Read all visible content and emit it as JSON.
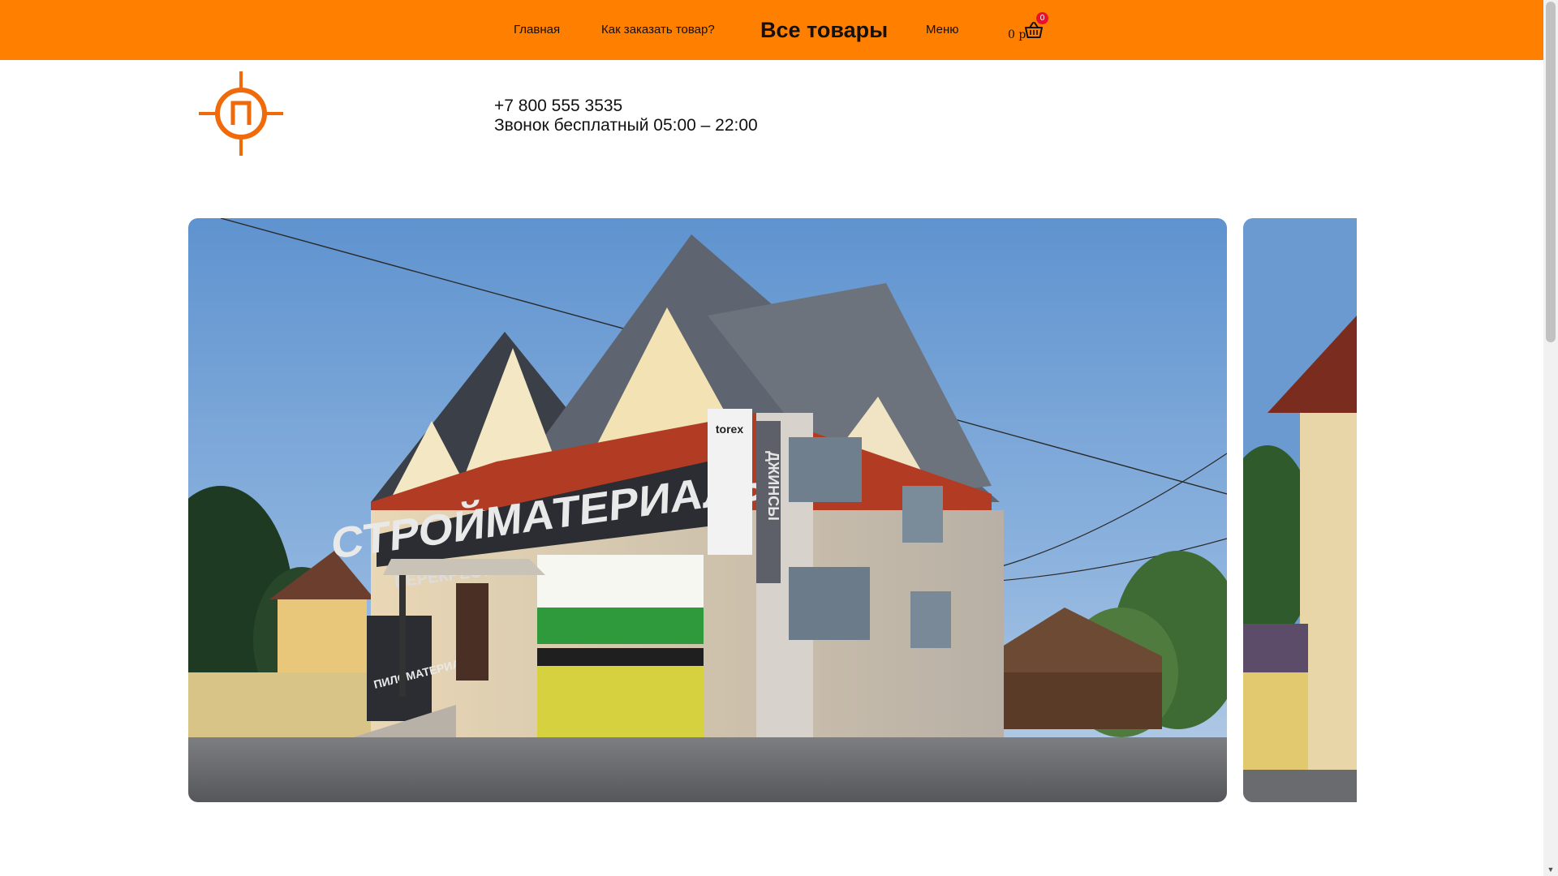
{
  "nav": {
    "home": "Главная",
    "how_to_order": "Как заказать товар?",
    "all_products": "Все товары",
    "menu": "Меню"
  },
  "cart": {
    "total": "0 р",
    "count": "0"
  },
  "contact": {
    "phone": "+7 800 555 3535",
    "hours": "Звонок бесплатный 05:00 – 22:00"
  },
  "logo": {
    "letter": "П"
  },
  "slider": {
    "sign_main": "СТРОЙМАТЕРИАЛЫ",
    "sign_sub": "ПЕРЕКРЕСТОК",
    "sign_side": "ДЖИНСЫ",
    "sign_torex": "torex",
    "sign_lower": "ПИЛОМАТЕРИАЛЫ"
  },
  "colors": {
    "accent": "#ff7f00",
    "badge": "#e8112d"
  }
}
